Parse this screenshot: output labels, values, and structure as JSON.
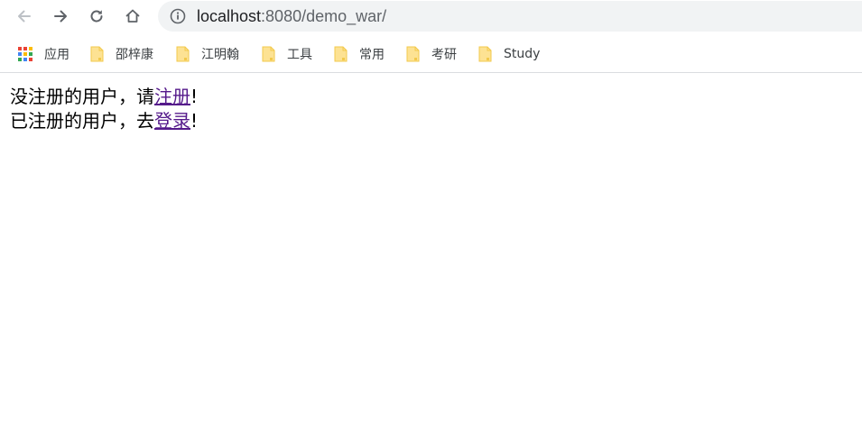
{
  "browser": {
    "url_host": "localhost",
    "url_path": ":8080/demo_war/"
  },
  "bookmarks": [
    {
      "label": "应用",
      "icon": "apps-grid-icon"
    },
    {
      "label": "邵梓康",
      "icon": "folder-icon"
    },
    {
      "label": "江明翰",
      "icon": "folder-icon"
    },
    {
      "label": "工具",
      "icon": "folder-icon"
    },
    {
      "label": "常用",
      "icon": "folder-icon"
    },
    {
      "label": "考研",
      "icon": "folder-icon"
    },
    {
      "label": "Study",
      "icon": "folder-icon"
    }
  ],
  "page": {
    "line1_prefix": "没注册的用户，请",
    "line1_link": "注册",
    "line1_suffix": "!",
    "line2_prefix": "已注册的用户，去",
    "line2_link": "登录",
    "line2_suffix": "!"
  },
  "colors": {
    "omnibox_bg": "#f1f3f4",
    "visited_link": "#551a8b",
    "folder": "#fde293"
  }
}
